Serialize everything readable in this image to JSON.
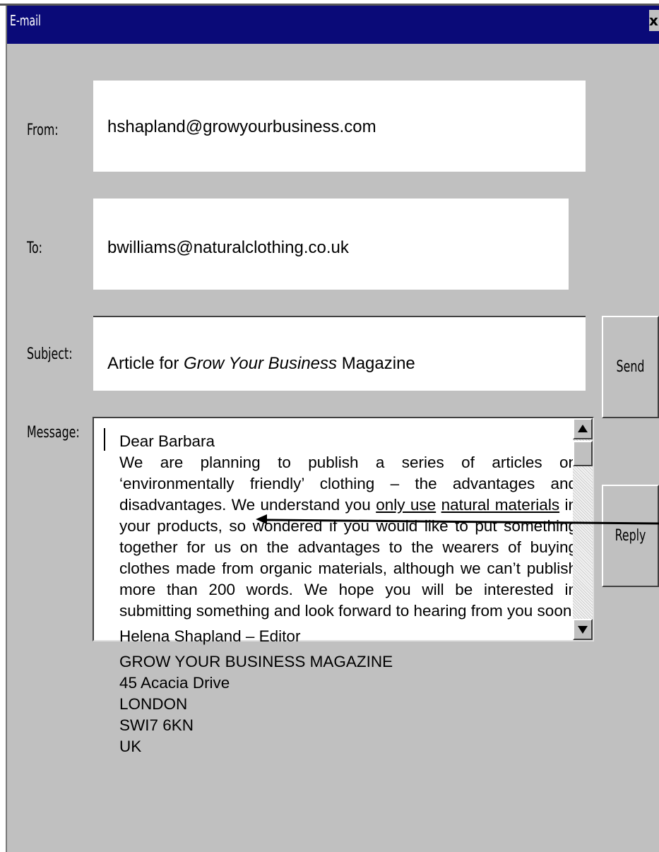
{
  "window": {
    "title": "E-mail",
    "close_glyph": "x"
  },
  "labels": {
    "from": "From:",
    "to": "To:",
    "subject": "Subject:",
    "message": "Message:"
  },
  "fields": {
    "from": "hshapland@growyourbusiness.com",
    "to": "bwilliams@naturalclothing.co.uk",
    "subject_prefix": "Article for ",
    "subject_italic": "Grow Your Business",
    "subject_suffix": " Magazine"
  },
  "buttons": {
    "send": "Send",
    "reply": "Reply"
  },
  "message": {
    "greeting": "Dear Barbara",
    "body_before": "We are planning to publish a series of articles on ‘environmentally friendly’ clothing – the advantages and disadvantages.  We understand you ",
    "body_underline_1": "only use",
    "body_underline_2": "natural materials",
    "body_after": " in your products, so wondered if you would like to put something together for us on the advantages to the wearers of buying clothes made from organic materials, although we can’t publish more than 200 words.  We hope you will be interested in submitting something and look forward to hearing from you soon.",
    "signature": "Helena Shapland – Editor",
    "address": [
      "GROW YOUR BUSINESS MAGAZINE",
      "45 Acacia Drive",
      "LONDON",
      "SWI7 6KN",
      "UK"
    ]
  },
  "icons": {
    "scroll_up": "scroll-up-arrow-icon",
    "scroll_down": "scroll-down-arrow-icon",
    "annotation": "annotation-arrow-icon"
  },
  "colors": {
    "titlebar": "#0a0a78",
    "window_bg": "#c0c0c0",
    "field_bg": "#ffffff"
  }
}
